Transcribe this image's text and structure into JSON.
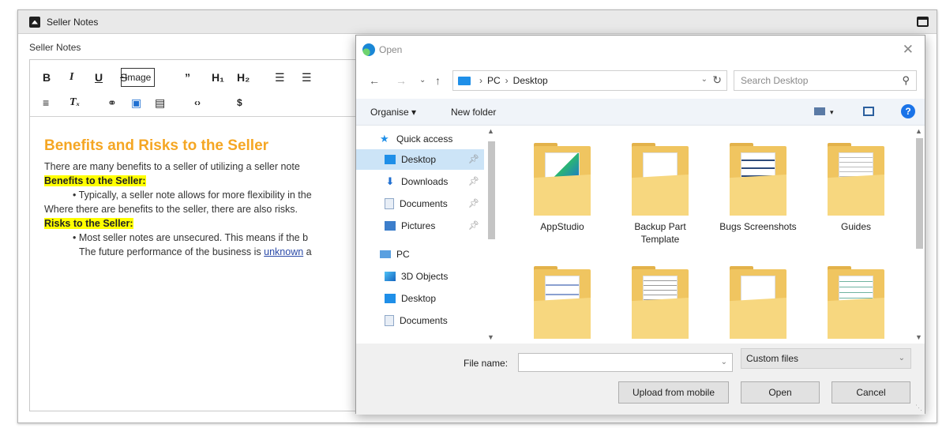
{
  "panel": {
    "title": "Seller Notes",
    "field_label": "Seller Notes"
  },
  "toolbar": {
    "bold": "B",
    "italic": "I",
    "underline": "U",
    "strike": "S",
    "image": "Image",
    "quote": "”",
    "h1": "H₁",
    "h2": "H₂",
    "ol": "☰",
    "ul": "☰",
    "align": "≡",
    "clear": "Tₓ",
    "link": "⚭",
    "img": "▣",
    "video": "▤",
    "code": "‹›",
    "dollar": "$"
  },
  "content": {
    "heading": "Benefits and Risks to the Seller",
    "p1": "There are many benefits to a seller of utilizing a seller note",
    "h_benefits": "Benefits to the Seller:",
    "bullet1": "• Typically, a seller note allows for more flexibility in the",
    "p2": "Where there are benefits to the seller, there are also risks.",
    "h_risks": "Risks to the Seller:",
    "bullet2": "• Most seller notes are unsecured. This means if the b",
    "p3_start": "The future performance of the business is ",
    "p3_link": "unknown",
    "p3_end": " a"
  },
  "dialog": {
    "title": "Open",
    "close": "✕",
    "breadcrumb": [
      "PC",
      "Desktop"
    ],
    "search_placeholder": "Search Desktop",
    "organise": "Organise ▾",
    "new_folder": "New folder",
    "help": "?",
    "nav": [
      {
        "label": "Quick access"
      },
      {
        "label": "Desktop"
      },
      {
        "label": "Downloads"
      },
      {
        "label": "Documents"
      },
      {
        "label": "Pictures"
      },
      {
        "label": "PC"
      },
      {
        "label": "3D Objects"
      },
      {
        "label": "Desktop"
      },
      {
        "label": "Documents"
      }
    ],
    "folders": [
      {
        "label": "AppStudio"
      },
      {
        "label": "Backup Part Template"
      },
      {
        "label": "Bugs Screenshots"
      },
      {
        "label": "Guides"
      },
      {
        "label": ""
      },
      {
        "label": ""
      },
      {
        "label": ""
      },
      {
        "label": ""
      }
    ],
    "file_name_label": "File name:",
    "file_name_value": "",
    "file_type": "Custom files",
    "buttons": {
      "upload": "Upload from mobile",
      "open": "Open",
      "cancel": "Cancel"
    }
  },
  "colors": {
    "accent": "#1f8fe8",
    "heading": "#f5a623",
    "highlight": "#ffff00",
    "selected": "#cce4f7"
  }
}
